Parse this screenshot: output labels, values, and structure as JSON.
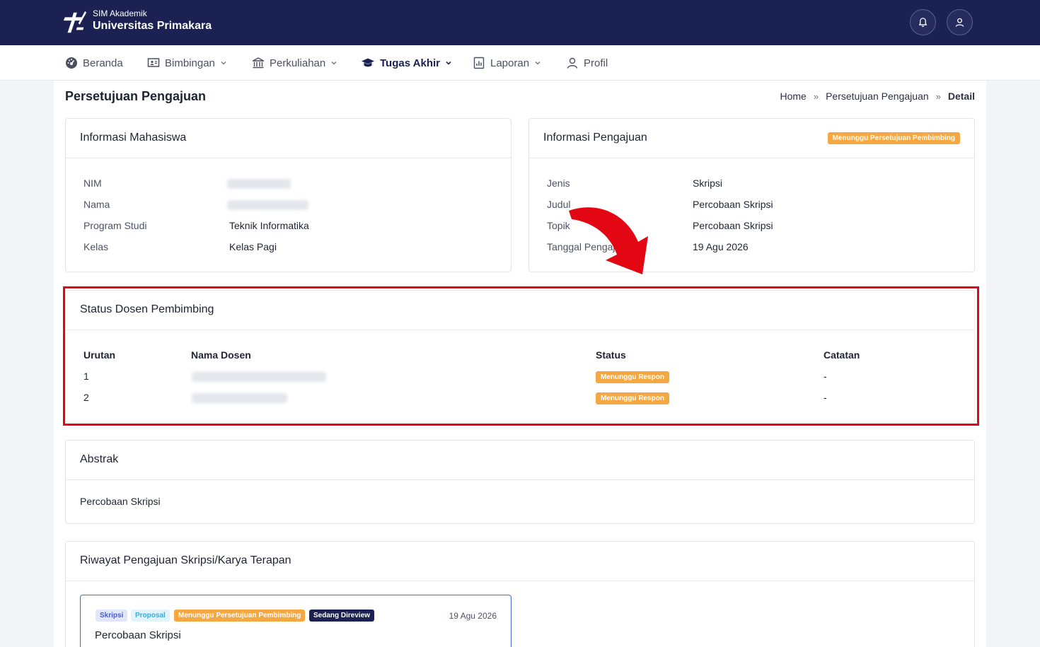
{
  "header": {
    "brand_subtitle": "SIM Akademik",
    "brand_title": "Universitas Primakara",
    "icons": [
      "bell-icon",
      "user-icon"
    ]
  },
  "nav": {
    "items": [
      {
        "label": "Beranda",
        "icon": "dashboard-icon",
        "dropdown": false
      },
      {
        "label": "Bimbingan",
        "icon": "board-icon",
        "dropdown": true
      },
      {
        "label": "Perkuliahan",
        "icon": "building-icon",
        "dropdown": true
      },
      {
        "label": "Tugas Akhir",
        "icon": "graduation-cap-icon",
        "dropdown": true,
        "active": true
      },
      {
        "label": "Laporan",
        "icon": "report-icon",
        "dropdown": true
      },
      {
        "label": "Profil",
        "icon": "person-icon",
        "dropdown": false
      }
    ]
  },
  "page": {
    "title": "Persetujuan Pengajuan",
    "breadcrumb": [
      "Home",
      "Persetujuan Pengajuan",
      "Detail"
    ]
  },
  "mahasiswa": {
    "title": "Informasi Mahasiswa",
    "rows": [
      {
        "label": "NIM",
        "value": ""
      },
      {
        "label": "Nama",
        "value": ""
      },
      {
        "label": "Program Studi",
        "value": "Teknik Informatika"
      },
      {
        "label": "Kelas",
        "value": "Kelas Pagi"
      }
    ]
  },
  "pengajuan": {
    "title": "Informasi Pengajuan",
    "status_badge": "Menunggu Persetujuan Pembimbing",
    "rows": [
      {
        "label": "Jenis",
        "value": "Skripsi"
      },
      {
        "label": "Judul",
        "value": "Percobaan Skripsi"
      },
      {
        "label": "Topik",
        "value": "Percobaan Skripsi"
      },
      {
        "label": "Tanggal Pengaju",
        "value": "19 Agu 2026"
      }
    ]
  },
  "dosen": {
    "title": "Status Dosen Pembimbing",
    "columns": [
      "Urutan",
      "Nama Dosen",
      "Status",
      "Catatan"
    ],
    "rows": [
      {
        "urutan": "1",
        "nama": "",
        "status": "Menunggu Respon",
        "catatan": "-"
      },
      {
        "urutan": "2",
        "nama": "",
        "status": "Menunggu Respon",
        "catatan": "-"
      }
    ]
  },
  "abstrak": {
    "title": "Abstrak",
    "text": "Percobaan Skripsi"
  },
  "riwayat": {
    "title": "Riwayat Pengajuan Skripsi/Karya Terapan",
    "items": [
      {
        "tags": [
          "Skripsi",
          "Proposal",
          "Menunggu Persetujuan Pembimbing",
          "Sedang Direview"
        ],
        "date": "19 Agu 2026",
        "title": "Percobaan Skripsi"
      }
    ]
  },
  "colors": {
    "header_bg": "#1b2152",
    "badge_orange": "#f5a841",
    "highlight_red": "#e30613",
    "link_blue": "#3b6fd4"
  }
}
